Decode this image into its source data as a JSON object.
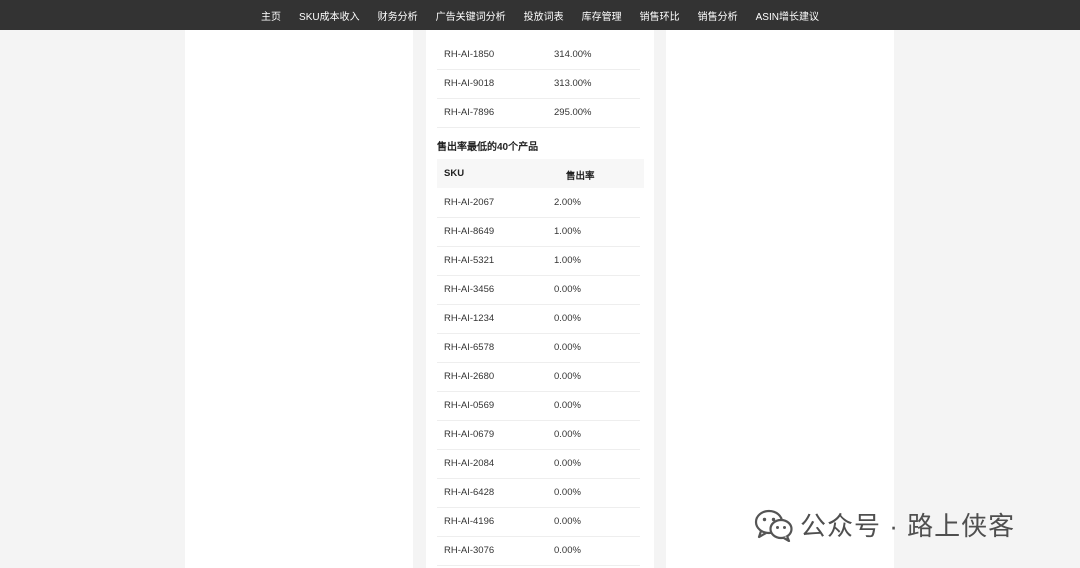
{
  "nav": {
    "items": [
      "主页",
      "SKU成本收入",
      "财务分析",
      "广告关键词分析",
      "投放词表",
      "库存管理",
      "销售环比",
      "销售分析",
      "ASIN增长建议"
    ]
  },
  "top_rows": [
    {
      "sku": "RH-AI-1850",
      "rate": "314.00%"
    },
    {
      "sku": "RH-AI-9018",
      "rate": "313.00%"
    },
    {
      "sku": "RH-AI-7896",
      "rate": "295.00%"
    }
  ],
  "lowest": {
    "title": "售出率最低的40个产品",
    "headers": {
      "sku": "SKU",
      "rate": "售出率"
    },
    "rows": [
      {
        "sku": "RH-AI-2067",
        "rate": "2.00%"
      },
      {
        "sku": "RH-AI-8649",
        "rate": "1.00%"
      },
      {
        "sku": "RH-AI-5321",
        "rate": "1.00%"
      },
      {
        "sku": "RH-AI-3456",
        "rate": "0.00%"
      },
      {
        "sku": "RH-AI-1234",
        "rate": "0.00%"
      },
      {
        "sku": "RH-AI-6578",
        "rate": "0.00%"
      },
      {
        "sku": "RH-AI-2680",
        "rate": "0.00%"
      },
      {
        "sku": "RH-AI-0569",
        "rate": "0.00%"
      },
      {
        "sku": "RH-AI-0679",
        "rate": "0.00%"
      },
      {
        "sku": "RH-AI-2084",
        "rate": "0.00%"
      },
      {
        "sku": "RH-AI-6428",
        "rate": "0.00%"
      },
      {
        "sku": "RH-AI-4196",
        "rate": "0.00%"
      },
      {
        "sku": "RH-AI-3076",
        "rate": "0.00%"
      }
    ]
  },
  "watermark": {
    "icon": "wechat-icon",
    "text": "公众号 · 路上侠客"
  },
  "colors": {
    "navbar": "#333333",
    "page_bg": "#f4f4f4",
    "panel_bg": "#ffffff",
    "header_row_bg": "#f7f7f7"
  }
}
